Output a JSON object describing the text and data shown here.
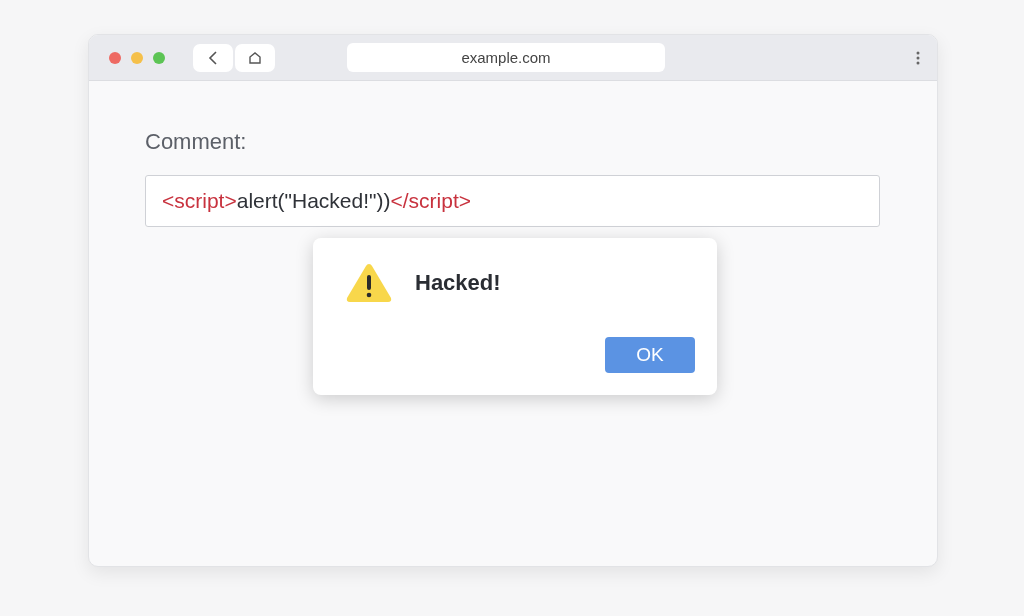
{
  "browser": {
    "address": "example.com"
  },
  "form": {
    "label": "Comment:",
    "value_segments": [
      {
        "kind": "tag",
        "text": "<script>"
      },
      {
        "kind": "text",
        "text": "alert(\"Hacked!\"))"
      },
      {
        "kind": "tag",
        "text": "</script>"
      }
    ]
  },
  "alert": {
    "message": "Hacked!",
    "buttons": [
      "OK"
    ]
  }
}
